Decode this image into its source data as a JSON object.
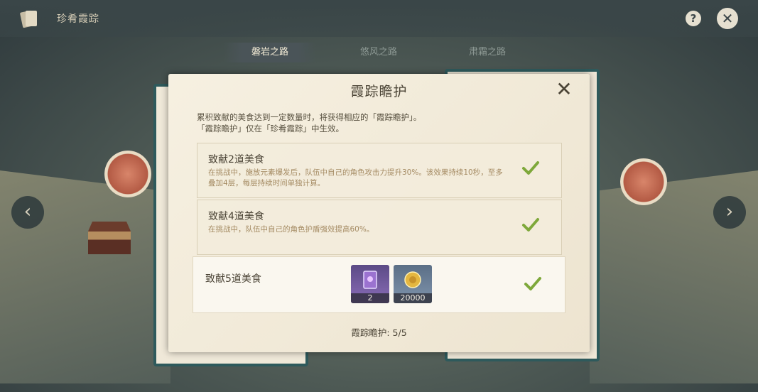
{
  "header": {
    "title": "珍肴霞踪"
  },
  "tabs": [
    {
      "label": "磐岩之路",
      "active": true
    },
    {
      "label": "悠风之路",
      "active": false
    },
    {
      "label": "肃霜之路",
      "active": false
    }
  ],
  "dialog": {
    "title": "霞踪瞻护",
    "description_lines": [
      "累积致献的美食达到一定数量时，将获得相应的「霞踪瞻护」。",
      "「霞踪瞻护」仅在「珍肴霞踪」中生效。"
    ],
    "rewards": [
      {
        "title": "致献2道美食",
        "desc": "在挑战中，施放元素爆发后，队伍中自己的角色攻击力提升30%。该效果持续10秒，至多叠加4层，每层持续时间单独计算。",
        "completed": true
      },
      {
        "title": "致献4道美食",
        "desc": "在挑战中，队伍中自己的角色护盾强效提高60%。",
        "completed": true
      },
      {
        "title": "致献5道美食",
        "items": [
          {
            "icon": "purple-book-icon",
            "count": "2"
          },
          {
            "icon": "mora-coin-icon",
            "count": "20000"
          }
        ],
        "completed": true
      }
    ],
    "progress": "霞踪瞻护: 5/5"
  },
  "colors": {
    "accent_check": "#7ea83a",
    "dialog_bg": "#f3ecdc",
    "frame": "#2e5a5c"
  }
}
